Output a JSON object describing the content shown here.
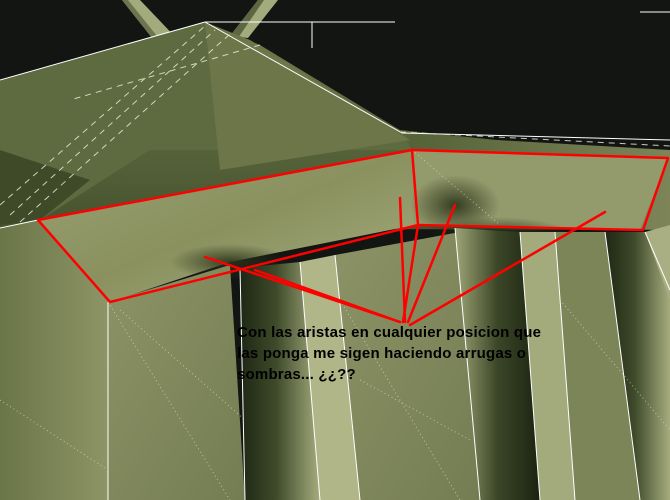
{
  "annotation": {
    "lines": [
      "Con las aristas en cualquier posicion que",
      "las ponga me sigen haciendo arrugas o",
      "sombras... ¿¿??"
    ]
  },
  "colors": {
    "background": "#121512",
    "mesh_light": "#a8ae82",
    "mesh_mid": "#7f8a5c",
    "mesh_dark": "#2f3b22",
    "markup_red": "#ff0000",
    "wire": "#ffffff"
  }
}
